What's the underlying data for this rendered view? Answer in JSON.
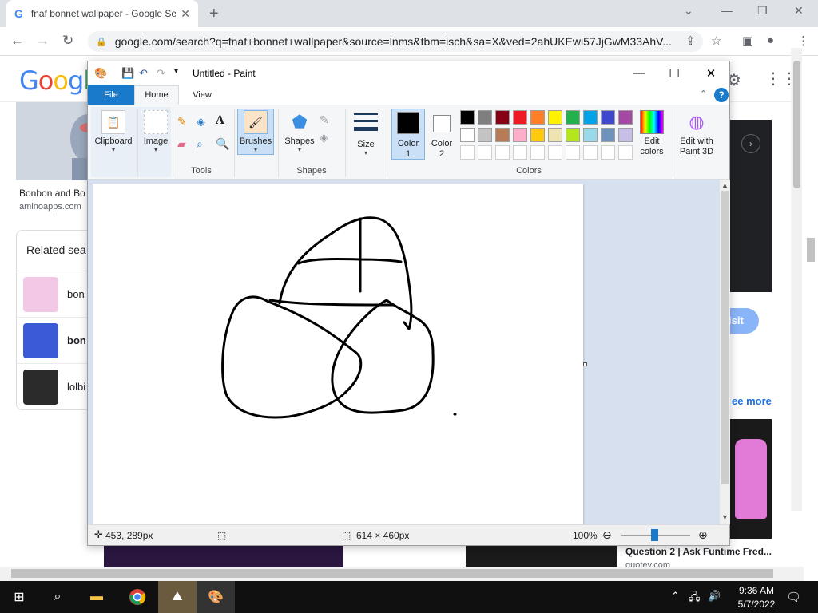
{
  "browser": {
    "tab_title": "fnaf bonnet wallpaper - Google Se",
    "url": "google.com/search?q=fnaf+bonnet+wallpaper&source=lnms&tbm=isch&sa=X&ved=2ahUKEwi57JjGwM33AhV..."
  },
  "google": {
    "logo": "Google",
    "result_title": "Bonbon and Bo",
    "result_source": "aminoapps.com",
    "related_title": "Related sea",
    "related": [
      {
        "label": "bon",
        "bold": false
      },
      {
        "label": "bon",
        "bold": true
      },
      {
        "label": "lolbi",
        "bold": false
      }
    ],
    "visit_label": "isit",
    "see_more_label": "ee more",
    "question_title": "Question 2 | Ask Funtime Fred...",
    "question_source": "quotev.com"
  },
  "paint": {
    "window_title": "Untitled - Paint",
    "tabs": {
      "file": "File",
      "home": "Home",
      "view": "View"
    },
    "groups": {
      "clipboard": "Clipboard",
      "image": "Image",
      "tools": "Tools",
      "brushes": "Brushes",
      "shapes_btn": "Shapes",
      "shapes_group": "Shapes",
      "size": "Size",
      "color1_line1": "Color",
      "color1_line2": "1",
      "color2_line1": "Color",
      "color2_line2": "2",
      "colors": "Colors",
      "edit_colors_line1": "Edit",
      "edit_colors_line2": "colors",
      "paint3d_line1": "Edit with",
      "paint3d_line2": "Paint 3D"
    },
    "palette_row1": [
      "#000000",
      "#7f7f7f",
      "#880015",
      "#ed1c24",
      "#ff7f27",
      "#fff200",
      "#22b14c",
      "#00a2e8",
      "#3f48cc",
      "#a349a4"
    ],
    "palette_row2": [
      "#ffffff",
      "#c3c3c3",
      "#b97a57",
      "#ffaec9",
      "#ffc90e",
      "#efe4b0",
      "#b5e61d",
      "#99d9ea",
      "#7092be",
      "#c8bfe7"
    ],
    "color1": "#000000",
    "color2": "#ffffff",
    "status": {
      "cursor_pos": "453, 289px",
      "canvas_size": "614 × 460px",
      "zoom": "100%"
    }
  },
  "taskbar": {
    "time": "9:36 AM",
    "date": "5/7/2022"
  }
}
